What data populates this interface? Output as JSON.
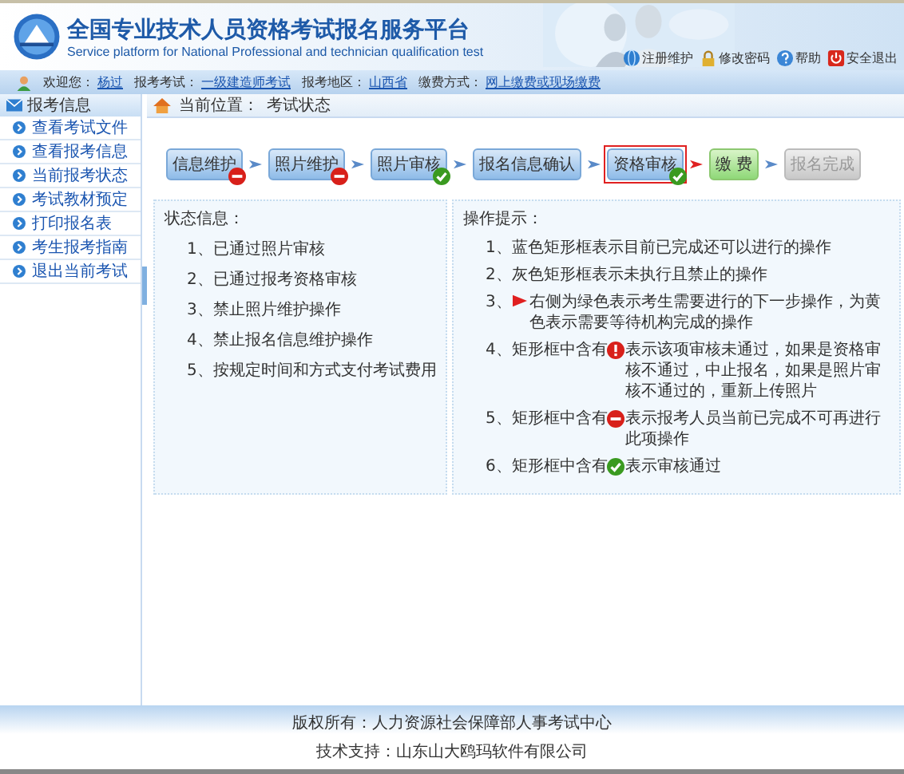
{
  "header": {
    "title": "全国专业技术人员资格考试报名服务平台",
    "subtitle": "Service platform for National Professional and technician qualification test",
    "links": [
      {
        "kind": "globe",
        "label": "注册维护"
      },
      {
        "kind": "lock",
        "label": "修改密码"
      },
      {
        "kind": "help",
        "label": "帮助"
      },
      {
        "kind": "power",
        "label": "安全退出"
      }
    ]
  },
  "info_bar": [
    {
      "label": "欢迎您：",
      "value": "杨过"
    },
    {
      "label": "报考考试：",
      "value": "一级建造师考试"
    },
    {
      "label": "报考地区：",
      "value": "山西省"
    },
    {
      "label": "缴费方式：",
      "value": "网上缴费或现场缴费"
    }
  ],
  "sidebar": {
    "title": "报考信息",
    "items": [
      {
        "label": "查看考试文件"
      },
      {
        "label": "查看报考信息"
      },
      {
        "label": "当前报考状态"
      },
      {
        "label": "考试教材预定"
      },
      {
        "label": "打印报名表"
      },
      {
        "label": "考生报考指南"
      },
      {
        "label": "退出当前考试"
      }
    ]
  },
  "breadcrumb": {
    "label": "当前位置：",
    "value": "考试状态"
  },
  "steps": [
    {
      "label": "信息维护",
      "kind": "locked",
      "selected": false
    },
    {
      "label": "照片维护",
      "kind": "locked",
      "selected": false
    },
    {
      "label": "照片审核",
      "kind": "passed",
      "selected": false
    },
    {
      "label": "报名信息确认",
      "kind": "open",
      "selected": false
    },
    {
      "label": "资格审核",
      "kind": "passed",
      "selected": true
    },
    {
      "label": "缴 费",
      "kind": "next",
      "selected": false
    },
    {
      "label": "报名完成",
      "kind": "disabled",
      "selected": false
    }
  ],
  "status": {
    "title": "状态信息：",
    "items": [
      "1、已通过照片审核",
      "2、已通过报考资格审核",
      "3、禁止照片维护操作",
      "4、禁止报名信息维护操作",
      "5、按规定时间和方式支付考试费用"
    ]
  },
  "hints": {
    "title": "操作提示：",
    "items": [
      {
        "kind": "plain",
        "before": "1、蓝色矩形框表示目前已完成还可以进行的操作"
      },
      {
        "kind": "plain",
        "before": "2、灰色矩形框表示未执行且禁止的操作"
      },
      {
        "kind": "pointer",
        "before": "3、",
        "after": "右侧为绿色表示考生需要进行的下一步操作，为黄色表示需要等待机构完成的操作"
      },
      {
        "kind": "failed",
        "before": "4、矩形框中含有",
        "after": "表示该项审核未通过，如果是资格审核不通过，中止报名，如果是照片审核不通过的，重新上传照片"
      },
      {
        "kind": "locked",
        "before": "5、矩形框中含有",
        "after": "表示报考人员当前已完成不可再进行此项操作"
      },
      {
        "kind": "passed",
        "before": "6、矩形框中含有",
        "after": "表示审核通过"
      }
    ]
  },
  "footer": [
    "版权所有：人力资源社会保障部人事考试中心",
    "技术支持：山东山大鸥玛软件有限公司"
  ]
}
